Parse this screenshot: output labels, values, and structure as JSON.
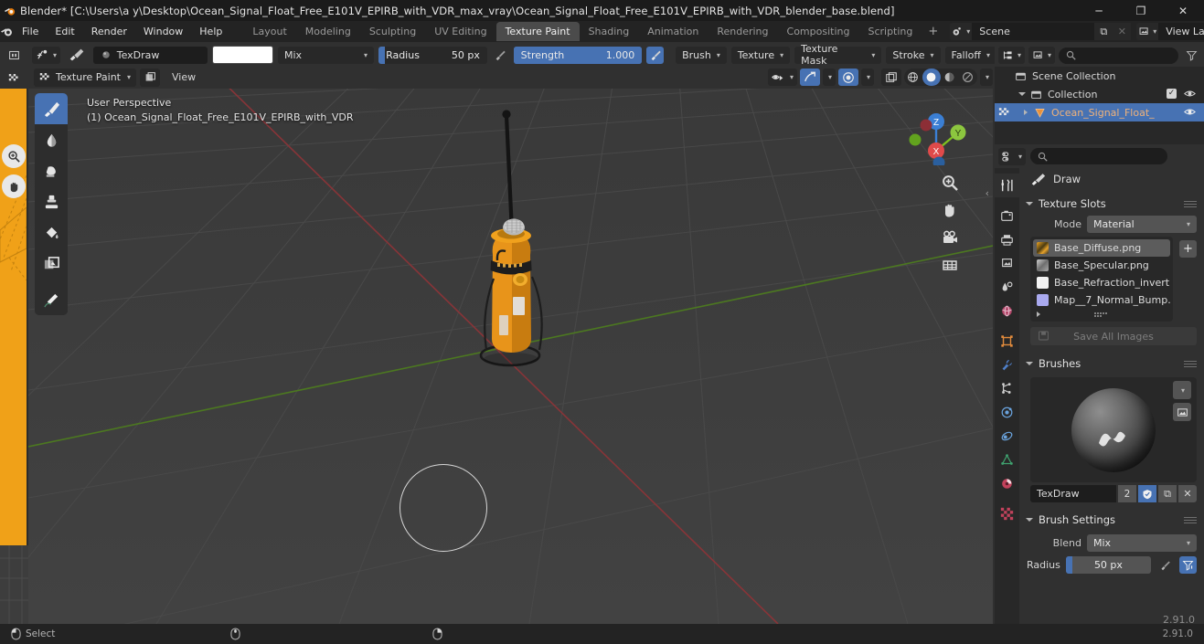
{
  "window": {
    "title": "Blender* [C:\\Users\\a y\\Desktop\\Ocean_Signal_Float_Free_E101V_EPIRB_with_VDR_max_vray\\Ocean_Signal_Float_Free_E101V_EPIRB_with_VDR_blender_base.blend]",
    "minimize": "─",
    "maximize": "❐",
    "close": "✕"
  },
  "menubar": {
    "items": [
      "File",
      "Edit",
      "Render",
      "Window",
      "Help"
    ]
  },
  "workspaces": {
    "tabs": [
      "Layout",
      "Modeling",
      "Sculpting",
      "UV Editing",
      "Texture Paint",
      "Shading",
      "Animation",
      "Rendering",
      "Compositing",
      "Scripting"
    ],
    "active": "Texture Paint",
    "add_label": "+"
  },
  "scene_selector": {
    "scene_name": "Scene",
    "view_layer_name": "View Layer",
    "new_label": "⧉",
    "remove_label": "✕"
  },
  "tool_header": {
    "brush_name": "TexDraw",
    "color_swatch": "#ffffff",
    "blend_label": "Mix",
    "radius_label": "Radius",
    "radius_value": "50 px",
    "radius_fill_pct": 6,
    "strength_label": "Strength",
    "strength_value": "1.000",
    "strength_fill_pct": 100,
    "menus": [
      "Brush",
      "Texture",
      "Texture Mask",
      "Stroke",
      "Falloff"
    ]
  },
  "viewport_header": {
    "mode": "Texture Paint",
    "view_menu": "View"
  },
  "viewport": {
    "perspective_label": "User Perspective",
    "object_label": "(1) Ocean_Signal_Float_Free_E101V_EPIRB_with_VDR",
    "gizmo_axes": [
      {
        "name": "Z",
        "color": "#3b7fd4"
      },
      {
        "name": "Y",
        "color": "#80c020"
      },
      {
        "name": "X",
        "color": "#e04a4a"
      }
    ],
    "nav_icons": [
      "zoom-icon",
      "hand-icon",
      "camera-icon",
      "grid-icon"
    ],
    "tools": [
      "draw-tool",
      "soften-tool",
      "smear-tool",
      "clone-tool",
      "fill-tool",
      "mask-tool",
      "annotate-tool"
    ],
    "active_tool": "draw-tool"
  },
  "outliner": {
    "search_placeholder": "",
    "rows": [
      {
        "label": "Scene Collection",
        "depth": 0,
        "icon": "collection-icon",
        "selected": false,
        "has_eye": false,
        "has_check": false,
        "expand": "none"
      },
      {
        "label": "Collection",
        "depth": 1,
        "icon": "collection-icon",
        "selected": false,
        "has_eye": true,
        "has_check": true,
        "expand": "down"
      },
      {
        "label": "Ocean_Signal_Float_",
        "depth": 2,
        "icon": "mesh-icon",
        "selected": true,
        "has_eye": true,
        "has_check": false,
        "expand": "right"
      }
    ]
  },
  "properties": {
    "breadcrumb": "Draw",
    "tabs": [
      "tool-tab",
      "render-tab",
      "output-tab",
      "view-layer-tab",
      "scene-tab",
      "world-tab",
      "object-tab",
      "modifier-tab",
      "particles-tab",
      "physics-tab",
      "constraints-tab",
      "data-tab",
      "material-tab",
      "texture-tab"
    ],
    "active_tab": "tool-tab",
    "texture_slots": {
      "title": "Texture Slots",
      "mode_label": "Mode",
      "mode_value": "Material",
      "add_label": "+",
      "slots": [
        {
          "name": "Base_Diffuse.png",
          "color": "#e8a32a",
          "selected": true
        },
        {
          "name": "Base_Specular.png",
          "color": "#9a9a9a",
          "selected": false
        },
        {
          "name": "Base_Refraction_invert....",
          "color": "#f2f2f2",
          "selected": false
        },
        {
          "name": "Map__7_Normal_Bump....",
          "color": "#a9a9ee",
          "selected": false
        }
      ],
      "save_all_label": "Save All Images"
    },
    "brushes": {
      "title": "Brushes",
      "brush_name": "TexDraw",
      "users_count": "2",
      "fake_user_label": "shield-icon",
      "duplicate_label": "⧉",
      "remove_label": "✕"
    },
    "brush_settings": {
      "title": "Brush Settings",
      "blend_label": "Blend",
      "blend_value": "Mix",
      "radius_label": "Radius",
      "radius_value": "50 px"
    },
    "version": "2.91.0"
  },
  "statusbar": {
    "items": [
      {
        "icon": "mouse-left-icon",
        "label": "Select"
      },
      {
        "icon": "mouse-middle-icon",
        "label": ""
      },
      {
        "icon": "mouse-right-icon",
        "label": ""
      }
    ],
    "version": "2.91.0"
  },
  "colors": {
    "accent_blue": "#4772b3",
    "panel_bg": "#303030",
    "editor_bg": "#282828",
    "viewport_bg": "#3d3d3d",
    "orange": "#f0a118"
  }
}
